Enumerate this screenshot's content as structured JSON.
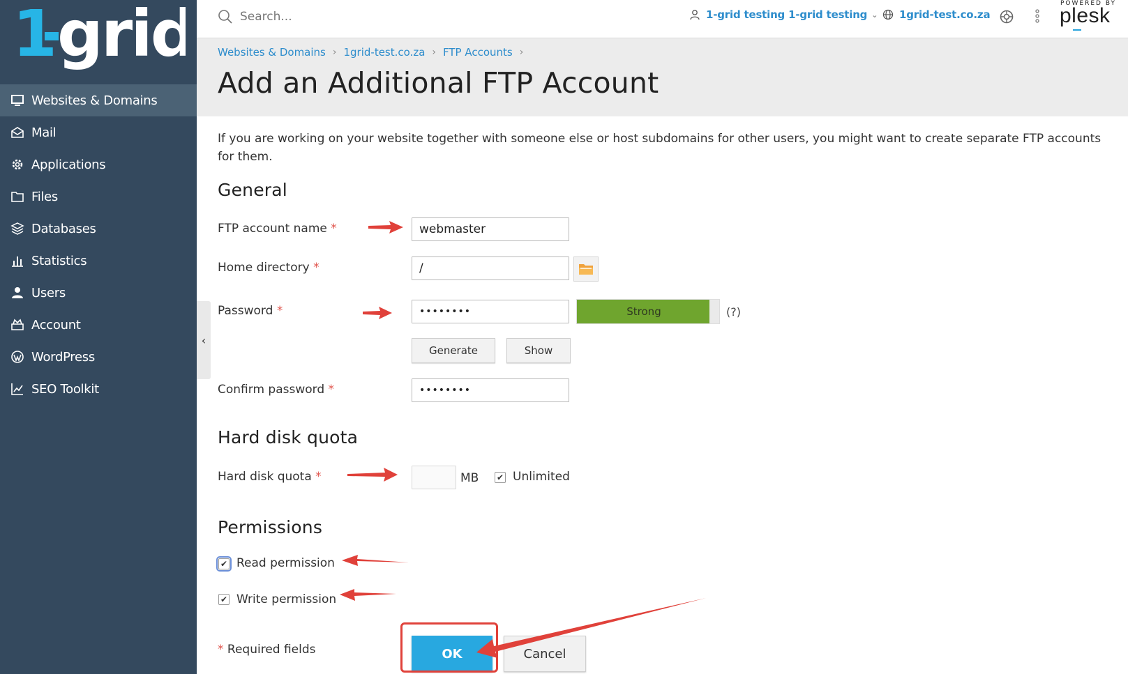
{
  "brand": {
    "logo_text": "1-grid",
    "colors": {
      "sidebar": "#34495e",
      "sidebar_active": "#4b6275",
      "accent": "#28a8e0",
      "link": "#2e8dcc",
      "strength_strong": "#6fa52e",
      "annotation": "#e0413a"
    }
  },
  "sidebar": {
    "items": [
      {
        "label": "Websites & Domains",
        "icon": "monitor-icon",
        "active": true
      },
      {
        "label": "Mail",
        "icon": "mail-icon"
      },
      {
        "label": "Applications",
        "icon": "gear-icon"
      },
      {
        "label": "Files",
        "icon": "folder-icon"
      },
      {
        "label": "Databases",
        "icon": "database-icon"
      },
      {
        "label": "Statistics",
        "icon": "bar-chart-icon"
      },
      {
        "label": "Users",
        "icon": "user-icon"
      },
      {
        "label": "Account",
        "icon": "account-icon"
      },
      {
        "label": "WordPress",
        "icon": "wordpress-icon"
      },
      {
        "label": "SEO Toolkit",
        "icon": "seo-chart-icon"
      }
    ]
  },
  "topbar": {
    "search_placeholder": "Search...",
    "user_label": "1-grid testing 1-grid testing",
    "domain_label": "1grid-test.co.za",
    "powered_by": "POWERED BY",
    "plesk": "plesk"
  },
  "breadcrumb": [
    "Websites & Domains",
    "1grid-test.co.za",
    "FTP Accounts"
  ],
  "page": {
    "title": "Add an Additional FTP Account",
    "intro": "If you are working on your website together with someone else or host subdomains for other users, you might want to create separate FTP accounts for them."
  },
  "general": {
    "title": "General",
    "ftp_name_label": "FTP account name",
    "ftp_name_value": "webmaster",
    "home_dir_label": "Home directory",
    "home_dir_value": "/",
    "password_label": "Password",
    "password_value": "••••••••",
    "strength_label": "Strong",
    "strength_level": 0.93,
    "help_label": "(?)",
    "generate_label": "Generate",
    "show_label": "Show",
    "confirm_label": "Confirm password",
    "confirm_value": "••••••••"
  },
  "quota": {
    "title": "Hard disk quota",
    "label": "Hard disk quota",
    "value": "",
    "unit": "MB",
    "unlimited_label": "Unlimited",
    "unlimited_checked": true
  },
  "permissions": {
    "title": "Permissions",
    "read_label": "Read permission",
    "read_checked": true,
    "write_label": "Write permission",
    "write_checked": true
  },
  "footer": {
    "required_star": "*",
    "required_label": "Required fields",
    "ok_label": "OK",
    "cancel_label": "Cancel"
  },
  "required_star": "*"
}
